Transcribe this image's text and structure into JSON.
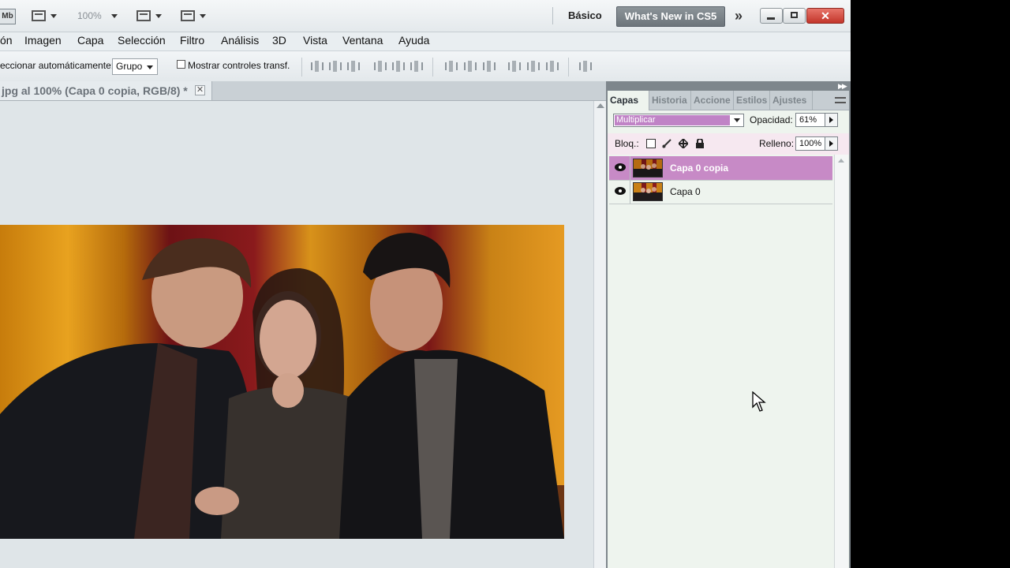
{
  "appbar": {
    "logo": "Mb",
    "zoom": "100%",
    "workspace_basic": "Básico",
    "workspace_new": "What's New in CS5",
    "more": "»",
    "close": "✕"
  },
  "menu": {
    "items": [
      "ón",
      "Imagen",
      "Capa",
      "Selección",
      "Filtro",
      "Análisis",
      "3D",
      "Vista",
      "Ventana",
      "Ayuda"
    ]
  },
  "options": {
    "auto_select_label": "eccionar automáticamente:",
    "auto_select_value": "Grupo",
    "show_transform_label": "Mostrar controles transf."
  },
  "document": {
    "tab_title": "jpg al 100% (Capa 0 copia, RGB/8) *",
    "close": "✕"
  },
  "panel": {
    "tabs": [
      "Capas",
      "Historia",
      "Accione",
      "Estilos",
      "Ajustes"
    ],
    "active_tab": "Capas",
    "blend_mode": "Multiplicar",
    "opacity_label": "Opacidad:",
    "opacity_value": "61%",
    "lock_label": "Bloq.:",
    "fill_label": "Relleno:",
    "fill_value": "100%",
    "layers": [
      {
        "name": "Capa 0 copia",
        "selected": true,
        "visible": true
      },
      {
        "name": "Capa 0",
        "selected": false,
        "visible": true
      }
    ]
  },
  "colors": {
    "selection_highlight": "#c78ac6",
    "panel_background": "#eef4ee",
    "button_dark": "#6d757b"
  }
}
